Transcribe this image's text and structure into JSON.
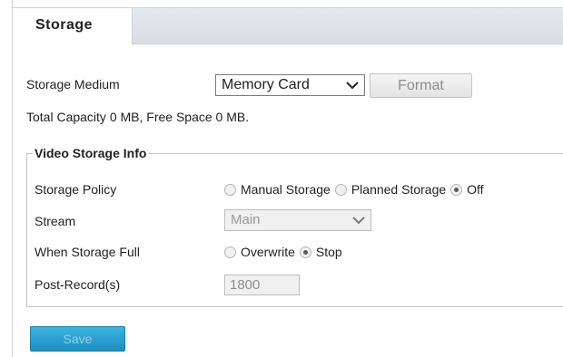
{
  "tab": {
    "label": "Storage"
  },
  "storage_medium": {
    "label": "Storage Medium",
    "selected": "Memory Card",
    "format_button": "Format"
  },
  "capacity_text": "Total Capacity 0 MB, Free Space 0 MB.",
  "video_storage": {
    "legend": "Video Storage Info",
    "policy": {
      "label": "Storage Policy",
      "options": [
        "Manual Storage",
        "Planned Storage",
        "Off"
      ],
      "selected": "Off"
    },
    "stream": {
      "label": "Stream",
      "selected": "Main"
    },
    "when_full": {
      "label": "When Storage Full",
      "options": [
        "Overwrite",
        "Stop"
      ],
      "selected": "Stop"
    },
    "post_record": {
      "label": "Post-Record(s)",
      "value": "1800"
    }
  },
  "save_button": "Save",
  "colors": {
    "save_button": "#2a9fd3",
    "tab_bar": "#dde1e6"
  }
}
